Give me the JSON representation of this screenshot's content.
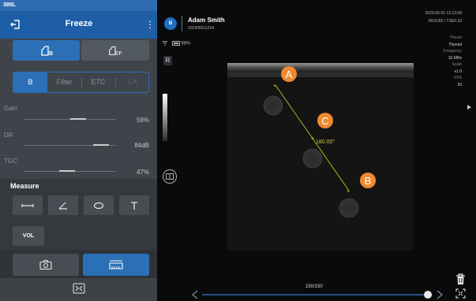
{
  "device_id": "380L",
  "header": {
    "title": "Freeze"
  },
  "modes": [
    {
      "name": "B",
      "active": true
    },
    {
      "name": "CF",
      "active": false
    }
  ],
  "tabs": [
    {
      "label": "B",
      "active": true
    },
    {
      "label": "Filter",
      "active": false
    },
    {
      "label": "ETC",
      "active": false
    },
    {
      "label": "CA",
      "active": false,
      "disabled": true
    }
  ],
  "params": {
    "gain": {
      "label": "Gain",
      "value": "59%",
      "level": 0.59
    },
    "dr": {
      "label": "DR",
      "value": "84dB",
      "level": 0.84
    },
    "tgc": {
      "label": "TGC",
      "value": "47%",
      "level": 0.47
    }
  },
  "measure": {
    "title": "Measure",
    "tools": [
      {
        "icon": "distance-icon"
      },
      {
        "icon": "angle-icon"
      },
      {
        "icon": "ellipse-icon"
      },
      {
        "icon": "text-icon"
      }
    ],
    "vol_label": "VOL"
  },
  "bottom_left": {
    "snapshot_icon": "camera-icon",
    "clip_icon": "clip-icon",
    "toggle_icon": "panel-collapse-icon"
  },
  "patient": {
    "logo_text": "B",
    "name": "Adam Smith",
    "id": "202306011234"
  },
  "device_meta": {
    "datetime": "2023-06-01 13:13:08",
    "model": "M10LB2 / TSE0.33"
  },
  "status": {
    "battery": "98%",
    "wifi_icon": "wifi-icon",
    "battery_icon": "battery-icon"
  },
  "orientation_marker": "R",
  "imaging_params": [
    {
      "key": "Preset",
      "value": "Thyroid"
    },
    {
      "key": "Frequency",
      "value": "10 MHz"
    },
    {
      "key": "Scale",
      "value": "x1.0"
    },
    {
      "key": "FPS",
      "value": "20"
    }
  ],
  "annotations": {
    "point_a": "A",
    "point_b": "B",
    "point_c": "C",
    "angle_readout": "180.00°"
  },
  "playback": {
    "frame_counter": "150/150",
    "position": 1.0
  },
  "colors": {
    "accent": "#2b6fb7",
    "measure_line": "#d6d62a",
    "annotation_circle": "#f08a2e"
  }
}
